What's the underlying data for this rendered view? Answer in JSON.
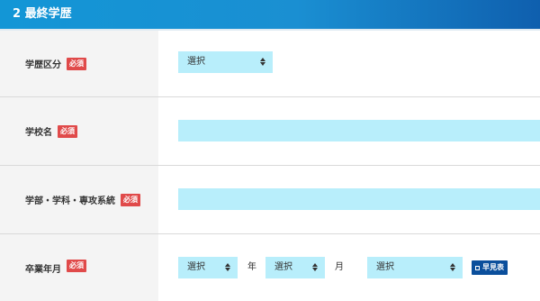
{
  "section": {
    "title": "2 最終学歴"
  },
  "required_badge": "必須",
  "rows": {
    "education_type": {
      "label": "学歴区分",
      "select_value": "選択"
    },
    "school_name": {
      "label": "学校名",
      "input_value": ""
    },
    "faculty": {
      "label": "学部・学科・専攻系統",
      "input_value": ""
    },
    "graduation": {
      "label": "卒業年月",
      "year_select": "選択",
      "year_unit": "年",
      "month_select": "選択",
      "month_unit": "月",
      "extra_select": "選択",
      "calendar_button": "早見表"
    }
  },
  "colors": {
    "header_gradient": [
      "#1396d6",
      "#0f5fae"
    ],
    "input_bg": "#b8eefb",
    "label_bg": "#f4f4f4",
    "required_badge": "#e04a4a",
    "calendar_button": "#0b4f9c"
  }
}
